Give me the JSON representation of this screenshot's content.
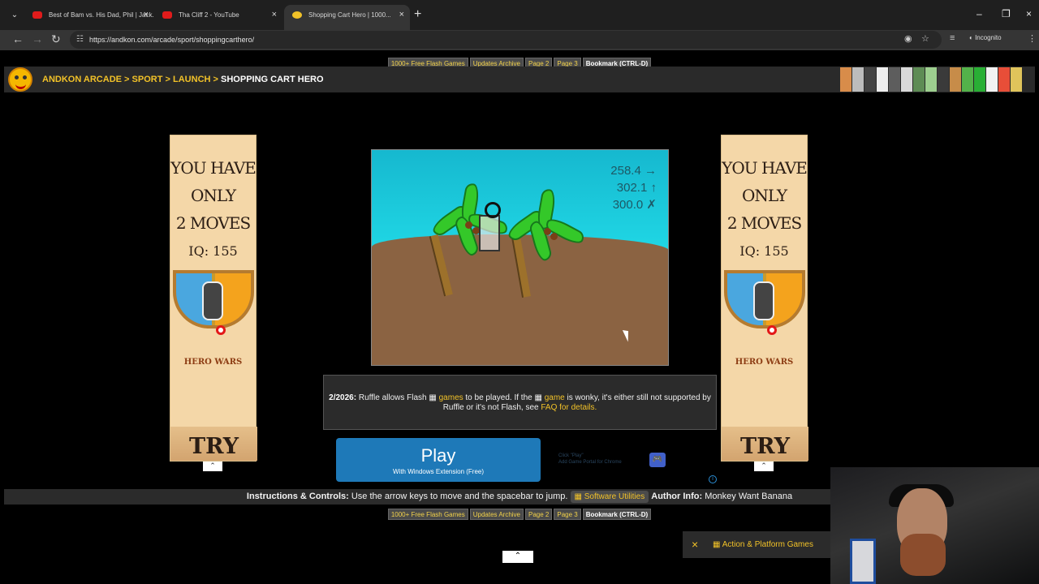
{
  "browser": {
    "tabs": [
      {
        "title": "Best of Bam vs. His Dad, Phil | Jack...",
        "fav": "#e01b1b"
      },
      {
        "title": "Tha Cliff 2 - YouTube",
        "fav": "#e01b1b"
      },
      {
        "title": "Shopping Cart Hero | 1000...",
        "fav": "#f2c228"
      }
    ],
    "url": "https://andkon.com/arcade/sport/shoppingcarthero/",
    "incognito": "Incognito"
  },
  "nav": {
    "links": [
      "1000+ Free Flash Games",
      "Updates Archive",
      "Page 2",
      "Page 3"
    ],
    "bookmark": "Bookmark (CTRL-D)"
  },
  "breadcrumb": {
    "a": "ANDKON ARCADE",
    "b": "SPORT",
    "c": "LAUNCH",
    "current": "SHOPPING CART HERO",
    "sep": ">"
  },
  "ad": {
    "line1": "YOU HAVE",
    "line2": "ONLY",
    "line3": "2 MOVES",
    "iq": "IQ: 155",
    "brand": "HERO WARS",
    "cta": "TRY"
  },
  "game": {
    "readouts": [
      {
        "value": "258.4",
        "icon": "→"
      },
      {
        "value": "302.1",
        "icon": "↑"
      },
      {
        "value": "300.0",
        "icon": "✗"
      }
    ]
  },
  "notice": {
    "date": "2/2026:",
    "text1": "Ruffle allows Flash",
    "games": "games",
    "text2": "to be played. If the",
    "game": "game",
    "text3": "is wonky, it's either still not supported by Ruffle or it's not Flash, see",
    "faq": "FAQ for details."
  },
  "play": {
    "title": "Play",
    "subtitle": "With Windows Extension (Free)",
    "hint1": "Click \"Play\"",
    "hint2": "Add Game Portal for Chrome"
  },
  "instructions": {
    "label": "Instructions & Controls:",
    "text": "Use the arrow keys to move and the spacebar to jump.",
    "software": "Software Utilities",
    "authorLabel": "Author Info:",
    "author": "Monkey Want Banana"
  },
  "actionPanel": {
    "label": "Action & Platform Games"
  },
  "colors": {
    "gold": "#f2c228",
    "blue": "#1e79b8"
  }
}
